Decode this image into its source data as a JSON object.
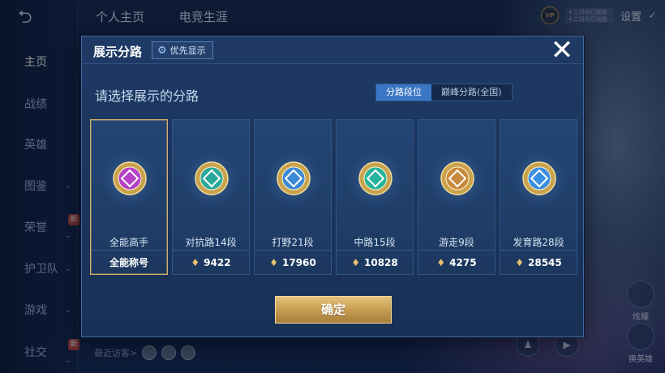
{
  "nav": {
    "back_icon": "back-arrow-icon",
    "items": [
      {
        "label": "主页",
        "active": true,
        "chevron": false,
        "new": false
      },
      {
        "label": "战绩",
        "active": false,
        "chevron": false,
        "new": false
      },
      {
        "label": "英雄",
        "active": false,
        "chevron": false,
        "new": false
      },
      {
        "label": "图鉴",
        "active": false,
        "chevron": true,
        "new": false
      },
      {
        "label": "荣誉",
        "active": false,
        "chevron": true,
        "new": true
      },
      {
        "label": "护卫队",
        "active": false,
        "chevron": true,
        "new": false
      },
      {
        "label": "游戏",
        "active": false,
        "chevron": true,
        "new": false
      },
      {
        "label": "社交",
        "active": false,
        "chevron": true,
        "new": true
      }
    ],
    "new_badge": "新"
  },
  "top_tabs": [
    "个人主页",
    "电竞生涯"
  ],
  "top_right": {
    "vip_label": "VIP",
    "info_lines": [
      "十二月份已结账",
      "十二月份已结账"
    ],
    "settings_label": "设置"
  },
  "recent_visitors_label": "最近访客>",
  "right_fabs": [
    "炫耀",
    "换英雄"
  ],
  "modal": {
    "title": "展示分路",
    "priority_label": "优先显示",
    "close_icon": "close-icon",
    "prompt": "请选择展示的分路",
    "segment": [
      "分路段位",
      "巅峰分路(全国)"
    ],
    "segment_active": 0,
    "cards": [
      {
        "label": "全能高手",
        "footer": "全能称号",
        "icon": "all-round-emblem-icon",
        "selected": true,
        "color": "#b640c8",
        "show_gem": false
      },
      {
        "label": "对抗路14段",
        "footer": "9422",
        "icon": "clash-lane-emblem-icon",
        "selected": false,
        "color": "#2aa89a",
        "show_gem": true
      },
      {
        "label": "打野21段",
        "footer": "17960",
        "icon": "jungle-emblem-icon",
        "selected": false,
        "color": "#3a8ad6",
        "show_gem": true
      },
      {
        "label": "中路15段",
        "footer": "10828",
        "icon": "mid-lane-emblem-icon",
        "selected": false,
        "color": "#25b39c",
        "show_gem": true
      },
      {
        "label": "游走9段",
        "footer": "4275",
        "icon": "roam-emblem-icon",
        "selected": false,
        "color": "#c9893c",
        "show_gem": true
      },
      {
        "label": "发育路28段",
        "footer": "28545",
        "icon": "farm-lane-emblem-icon",
        "selected": false,
        "color": "#3b8fe0",
        "show_gem": true
      }
    ],
    "confirm_label": "确定"
  },
  "colors": {
    "accent_gold": "#d6b06a",
    "segment_active": "#3a76c4",
    "modal_bg": "#1e3a64"
  }
}
